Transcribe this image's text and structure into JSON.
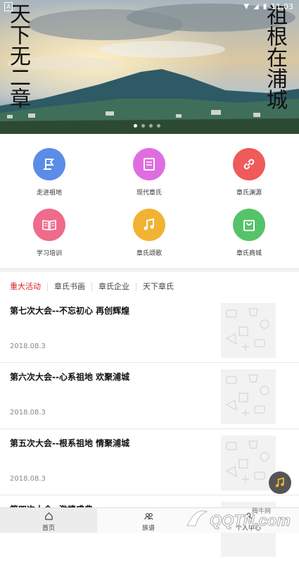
{
  "status_bar": {
    "time": "11:03",
    "sim_label": "A"
  },
  "banner": {
    "left_text": "天下无二章",
    "right_text": "祖根在浦城",
    "page_count": 4,
    "active_page": 0
  },
  "grid": [
    {
      "label": "走进祖地",
      "icon": "flag-icon",
      "color": "#5b8de8"
    },
    {
      "label": "现代章氏",
      "icon": "book-icon",
      "color": "#e06de0"
    },
    {
      "label": "章氏渊源",
      "icon": "link-icon",
      "color": "#ef5a5a"
    },
    {
      "label": "学习培训",
      "icon": "open-book-icon",
      "color": "#f06a8c"
    },
    {
      "label": "章氏颂歌",
      "icon": "music-note-icon",
      "color": "#f2b233"
    },
    {
      "label": "章氏商城",
      "icon": "shopping-bag-icon",
      "color": "#55c468"
    }
  ],
  "tabs": [
    {
      "label": "重大活动",
      "active": true
    },
    {
      "label": "章氏书画",
      "active": false
    },
    {
      "label": "章氏企业",
      "active": false
    },
    {
      "label": "天下章氏",
      "active": false
    }
  ],
  "articles": [
    {
      "title": "第七次大会--不忘初心 再创辉煌",
      "date": "2018.08.3"
    },
    {
      "title": "第六次大会--心系祖地 欢聚浦城",
      "date": "2018.08.3"
    },
    {
      "title": "第五次大会--根系祖地 情聚浦城",
      "date": "2018.08.3"
    },
    {
      "title": "第四次大会--激情盛典",
      "date": ""
    }
  ],
  "bottom_nav": [
    {
      "label": "首页",
      "icon": "home-icon",
      "active": true
    },
    {
      "label": "族谱",
      "icon": "people-icon",
      "active": false
    },
    {
      "label": "个人中心",
      "icon": "user-icon",
      "active": false
    }
  ],
  "watermark": {
    "text": "QQTN.com",
    "sub": "腾牛网"
  },
  "colors": {
    "accent": "#e02020",
    "active_tab": "#e02020"
  }
}
